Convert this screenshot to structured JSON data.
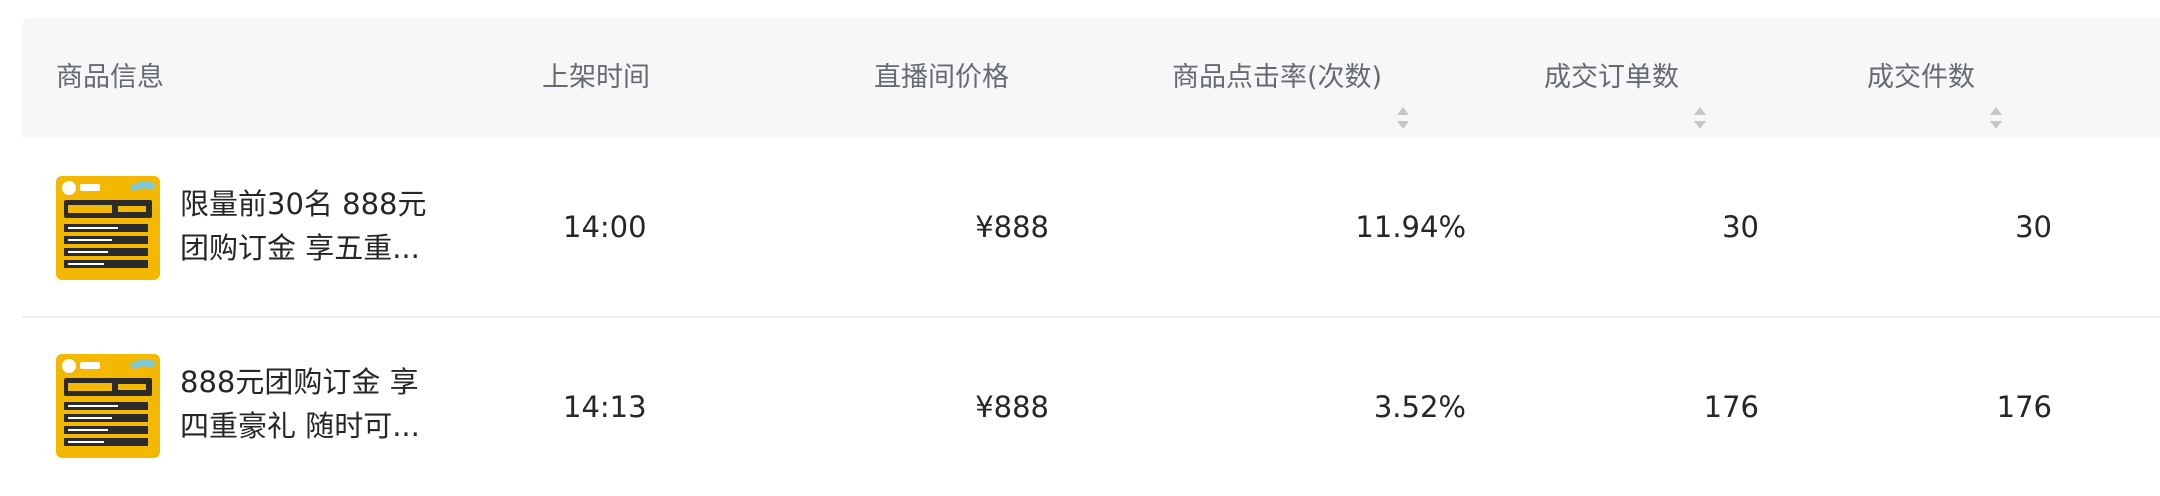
{
  "columns": {
    "product_info": "商品信息",
    "listed_time": "上架时间",
    "live_price": "直播间价格",
    "click_rate": "商品点击率(次数)",
    "orders": "成交订单数",
    "items": "成交件数"
  },
  "rows": [
    {
      "name_line1": "限量前30名 888元",
      "name_line2": "团购订金 享五重...",
      "listed_time": "14:00",
      "price": "¥888",
      "click_rate": "11.94%",
      "orders": "30",
      "items": "30"
    },
    {
      "name_line1": "888元团购订金 享",
      "name_line2": "四重豪礼 随时可...",
      "listed_time": "14:13",
      "price": "¥888",
      "click_rate": "3.52%",
      "orders": "176",
      "items": "176"
    }
  ],
  "colors": {
    "header_bg": "#f7f7f8",
    "thumb_yellow": "#f5b800",
    "thumb_dark": "#2b2b2b",
    "sort_icon": "#c4c6cc"
  },
  "icons": {
    "sort": "sort-up-down-icon",
    "thumbnail": "product-thumbnail"
  }
}
